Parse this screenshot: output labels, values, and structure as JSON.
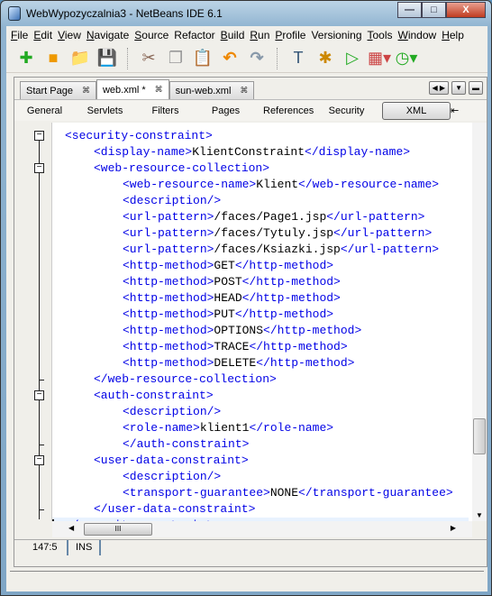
{
  "window": {
    "title": "WebWypozyczalnia3 - NetBeans IDE 6.1"
  },
  "menu": [
    {
      "u": "F",
      "r": "ile"
    },
    {
      "u": "E",
      "r": "dit"
    },
    {
      "u": "V",
      "r": "iew"
    },
    {
      "u": "N",
      "r": "avigate"
    },
    {
      "u": "S",
      "r": "ource"
    },
    {
      "u": "Ref",
      "r": "actor",
      "ul": "a"
    },
    {
      "u": "B",
      "r": "uild"
    },
    {
      "u": "R",
      "r": "un"
    },
    {
      "u": "P",
      "r": "rofile"
    },
    {
      "u": "Versi",
      "r": "oning"
    },
    {
      "u": "T",
      "r": "ools"
    },
    {
      "u": "W",
      "r": "indow"
    },
    {
      "u": "H",
      "r": "elp"
    }
  ],
  "toolbar": [
    "new-file",
    "new-project",
    "open-project",
    "save-all",
    "cut",
    "copy",
    "paste",
    "undo",
    "redo",
    "build",
    "clean-build",
    "run",
    "debug",
    "profile"
  ],
  "tabs": [
    {
      "label": "Start Page"
    },
    {
      "label": "web.xml *",
      "active": true
    },
    {
      "label": "sun-web.xml"
    }
  ],
  "views": [
    "General",
    "Servlets",
    "Filters",
    "Pages",
    "References",
    "Security",
    "XML"
  ],
  "active_view": "XML",
  "code": [
    {
      "i": 0,
      "fold": "open",
      "s": [
        [
          "tag",
          "<security-constraint>"
        ]
      ]
    },
    {
      "i": 1,
      "s": [
        [
          "tag",
          "<display-name>"
        ],
        [
          "txt",
          "KlientConstraint"
        ],
        [
          "tag",
          "</display-name>"
        ]
      ]
    },
    {
      "i": 1,
      "fold": "open",
      "s": [
        [
          "tag",
          "<web-resource-collection>"
        ]
      ]
    },
    {
      "i": 2,
      "s": [
        [
          "tag",
          "<web-resource-name>"
        ],
        [
          "txt",
          "Klient"
        ],
        [
          "tag",
          "</web-resource-name>"
        ]
      ]
    },
    {
      "i": 2,
      "s": [
        [
          "tag",
          "<description/>"
        ]
      ]
    },
    {
      "i": 2,
      "s": [
        [
          "tag",
          "<url-pattern>"
        ],
        [
          "txt",
          "/faces/Page1.jsp"
        ],
        [
          "tag",
          "</url-pattern>"
        ]
      ]
    },
    {
      "i": 2,
      "s": [
        [
          "tag",
          "<url-pattern>"
        ],
        [
          "txt",
          "/faces/Tytuly.jsp"
        ],
        [
          "tag",
          "</url-pattern>"
        ]
      ]
    },
    {
      "i": 2,
      "s": [
        [
          "tag",
          "<url-pattern>"
        ],
        [
          "txt",
          "/faces/Ksiazki.jsp"
        ],
        [
          "tag",
          "</url-pattern>"
        ]
      ]
    },
    {
      "i": 2,
      "s": [
        [
          "tag",
          "<http-method>"
        ],
        [
          "txt",
          "GET"
        ],
        [
          "tag",
          "</http-method>"
        ]
      ]
    },
    {
      "i": 2,
      "s": [
        [
          "tag",
          "<http-method>"
        ],
        [
          "txt",
          "POST"
        ],
        [
          "tag",
          "</http-method>"
        ]
      ]
    },
    {
      "i": 2,
      "s": [
        [
          "tag",
          "<http-method>"
        ],
        [
          "txt",
          "HEAD"
        ],
        [
          "tag",
          "</http-method>"
        ]
      ]
    },
    {
      "i": 2,
      "s": [
        [
          "tag",
          "<http-method>"
        ],
        [
          "txt",
          "PUT"
        ],
        [
          "tag",
          "</http-method>"
        ]
      ]
    },
    {
      "i": 2,
      "s": [
        [
          "tag",
          "<http-method>"
        ],
        [
          "txt",
          "OPTIONS"
        ],
        [
          "tag",
          "</http-method>"
        ]
      ]
    },
    {
      "i": 2,
      "s": [
        [
          "tag",
          "<http-method>"
        ],
        [
          "txt",
          "TRACE"
        ],
        [
          "tag",
          "</http-method>"
        ]
      ]
    },
    {
      "i": 2,
      "s": [
        [
          "tag",
          "<http-method>"
        ],
        [
          "txt",
          "DELETE"
        ],
        [
          "tag",
          "</http-method>"
        ]
      ]
    },
    {
      "i": 1,
      "fold": "end",
      "s": [
        [
          "tag",
          "</web-resource-collection>"
        ]
      ]
    },
    {
      "i": 1,
      "fold": "open",
      "s": [
        [
          "tag",
          "<auth-constraint>"
        ]
      ]
    },
    {
      "i": 2,
      "s": [
        [
          "tag",
          "<description/>"
        ]
      ]
    },
    {
      "i": 2,
      "s": [
        [
          "tag",
          "<role-name>"
        ],
        [
          "txt",
          "klient1"
        ],
        [
          "tag",
          "</role-name>"
        ]
      ]
    },
    {
      "i": 2,
      "fold": "end",
      "s": [
        [
          "tag",
          "</auth-constraint>"
        ]
      ]
    },
    {
      "i": 1,
      "fold": "open",
      "s": [
        [
          "tag",
          "<user-data-constraint>"
        ]
      ]
    },
    {
      "i": 2,
      "s": [
        [
          "tag",
          "<description/>"
        ]
      ]
    },
    {
      "i": 2,
      "s": [
        [
          "tag",
          "<transport-guarantee>"
        ],
        [
          "txt",
          "NONE"
        ],
        [
          "tag",
          "</transport-guarantee>"
        ]
      ]
    },
    {
      "i": 1,
      "fold": "end",
      "s": [
        [
          "tag",
          "</user-data-constraint>"
        ]
      ]
    },
    {
      "i": 0,
      "fold": "end",
      "cur": true,
      "s": [
        [
          "tag",
          "</security-constraint>"
        ]
      ]
    }
  ],
  "status": {
    "position": "147:5",
    "mode": "INS"
  }
}
